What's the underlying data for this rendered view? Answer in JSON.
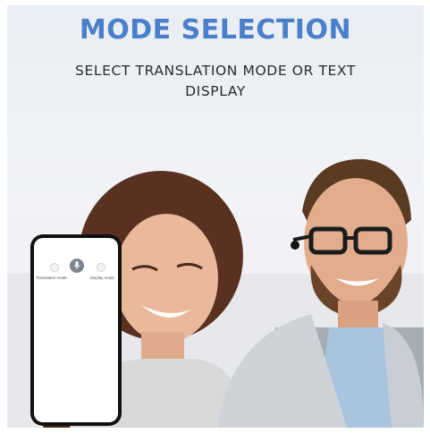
{
  "banner": {
    "title": "MODE SELECTION",
    "subtitle": "SELECT TRANSLATION MODE OR TEXT DISPLAY"
  },
  "phone": {
    "left_mode_label": "Translation mode",
    "right_mode_label": "Display mode",
    "mic_icon": "microphone-icon"
  },
  "colors": {
    "title_blue": "#4a7fc9",
    "background": "#eef1f4"
  }
}
